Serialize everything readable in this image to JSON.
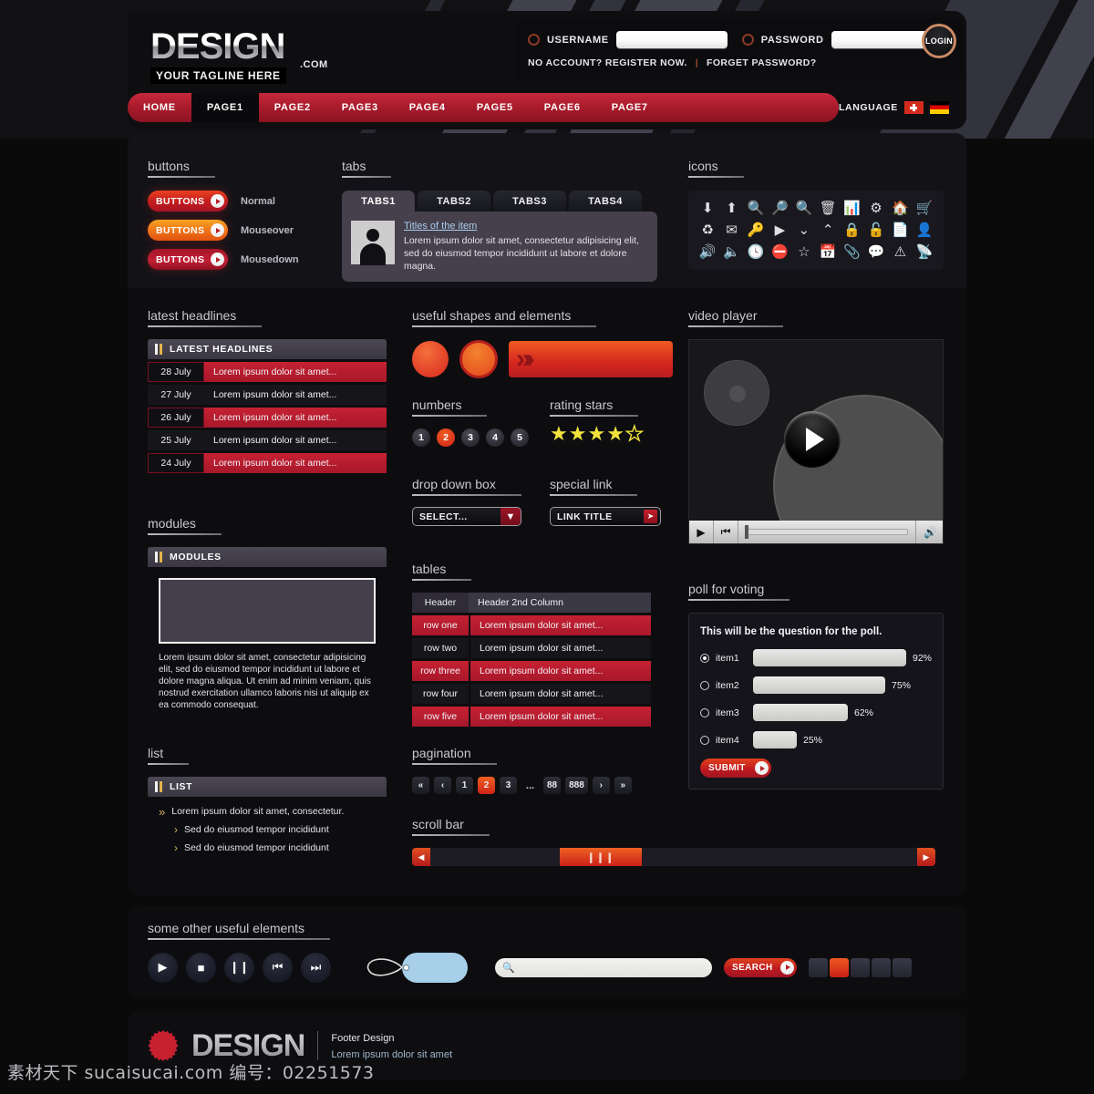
{
  "brand": {
    "logo": "DESIGN",
    "dotcom": ".COM",
    "tagline": "YOUR TAGLINE HERE"
  },
  "login": {
    "username_label": "USERNAME",
    "password_label": "PASSWORD",
    "username_value": "",
    "password_value": "",
    "username_placeholder": "",
    "password_placeholder": "",
    "button_label": "LOGIN",
    "register_link": "NO ACCOUNT? REGISTER NOW.",
    "separator": "|",
    "forgot_link": "FORGET PASSWORD?"
  },
  "nav": {
    "items": [
      {
        "label": "HOME",
        "active": false
      },
      {
        "label": "PAGE1",
        "active": true
      },
      {
        "label": "PAGE2",
        "active": false
      },
      {
        "label": "PAGE3",
        "active": false
      },
      {
        "label": "PAGE4",
        "active": false
      },
      {
        "label": "PAGE5",
        "active": false
      },
      {
        "label": "PAGE6",
        "active": false
      },
      {
        "label": "PAGE7",
        "active": false
      }
    ],
    "language_label": "LANGUAGE",
    "flags": [
      "flag-switzerland",
      "flag-germany"
    ]
  },
  "sections": {
    "buttons": "buttons",
    "tabs": "tabs",
    "icons": "icons",
    "headlines": "latest headlines",
    "shapes": "useful shapes and elements",
    "video": "video player",
    "numbers": "numbers",
    "rating": "rating stars",
    "dropdown": "drop down box",
    "special_link": "special link",
    "modules": "modules",
    "tables": "tables",
    "poll": "poll for voting",
    "list": "list",
    "pagination": "pagination",
    "scrollbar": "scroll bar",
    "other": "some other useful elements"
  },
  "buttons_demo": [
    {
      "label": "BUTTONS",
      "state": "Normal"
    },
    {
      "label": "BUTTONS",
      "state": "Mouseover"
    },
    {
      "label": "BUTTONS",
      "state": "Mousedown"
    }
  ],
  "tabs_demo": {
    "tabs": [
      {
        "label": "TABS1",
        "active": true
      },
      {
        "label": "TABS2",
        "active": false
      },
      {
        "label": "TABS3",
        "active": false
      },
      {
        "label": "TABS4",
        "active": false
      }
    ],
    "title": "Titles of the item",
    "body": "Lorem ipsum dolor sit amet, consectetur adipisicing elit, sed do eiusmod tempor incididunt ut labore et dolore magna."
  },
  "icons_grid": [
    {
      "name": "arrow-down-icon",
      "glyph": "⬇"
    },
    {
      "name": "arrow-up-icon",
      "glyph": "⬆"
    },
    {
      "name": "zoom-in-icon",
      "glyph": "🔍"
    },
    {
      "name": "zoom-out-icon",
      "glyph": "🔎"
    },
    {
      "name": "search-icon",
      "glyph": "🔍"
    },
    {
      "name": "trash-icon",
      "glyph": "🗑"
    },
    {
      "name": "bar-chart-icon",
      "glyph": "📊"
    },
    {
      "name": "gear-icon",
      "glyph": "⚙"
    },
    {
      "name": "home-icon",
      "glyph": "🏠"
    },
    {
      "name": "cart-icon",
      "glyph": "🛒"
    },
    {
      "name": "refresh-icon",
      "glyph": "♻"
    },
    {
      "name": "mail-icon",
      "glyph": "✉"
    },
    {
      "name": "key-icon",
      "glyph": "🔑"
    },
    {
      "name": "play-circle-icon",
      "glyph": "▶"
    },
    {
      "name": "collapse-down-icon",
      "glyph": "⌄"
    },
    {
      "name": "expand-up-icon",
      "glyph": "⌃"
    },
    {
      "name": "lock-closed-icon",
      "glyph": "🔒"
    },
    {
      "name": "lock-open-icon",
      "glyph": "🔓"
    },
    {
      "name": "document-icon",
      "glyph": "📄"
    },
    {
      "name": "user-icon",
      "glyph": "👤"
    },
    {
      "name": "volume-on-icon",
      "glyph": "🔊"
    },
    {
      "name": "volume-off-icon",
      "glyph": "🔈"
    },
    {
      "name": "clock-icon",
      "glyph": "🕓"
    },
    {
      "name": "block-icon",
      "glyph": "⛔"
    },
    {
      "name": "star-icon",
      "glyph": "☆"
    },
    {
      "name": "calendar-icon",
      "glyph": "📅"
    },
    {
      "name": "attachment-icon",
      "glyph": "📎"
    },
    {
      "name": "comment-icon",
      "glyph": "💬"
    },
    {
      "name": "warning-icon",
      "glyph": "⚠"
    },
    {
      "name": "rss-icon",
      "glyph": "📡"
    }
  ],
  "headlines_widget": {
    "title": "LATEST HEADLINES",
    "rows": [
      {
        "date": "28 July",
        "text": "Lorem ipsum dolor sit amet...",
        "highlight": true
      },
      {
        "date": "27 July",
        "text": "Lorem ipsum dolor sit amet...",
        "highlight": false
      },
      {
        "date": "26 July",
        "text": "Lorem ipsum dolor sit amet...",
        "highlight": true
      },
      {
        "date": "25 July",
        "text": "Lorem ipsum dolor sit amet...",
        "highlight": false
      },
      {
        "date": "24 July",
        "text": "Lorem ipsum dolor sit amet...",
        "highlight": true
      }
    ]
  },
  "modules_widget": {
    "title": "MODULES",
    "text": "Lorem ipsum dolor sit amet, consectetur adipisicing elit, sed do eiusmod tempor incididunt ut labore et dolore magna aliqua. Ut enim ad minim veniam, quis nostrud exercitation ullamco laboris nisi ut aliquip ex ea commodo consequat."
  },
  "list_widget": {
    "title": "LIST",
    "items": [
      {
        "text": "Lorem ipsum dolor sit amet, consectetur.",
        "sub": false
      },
      {
        "text": "Sed do eiusmod tempor incididunt",
        "sub": true
      },
      {
        "text": "Sed do eiusmod tempor incididunt",
        "sub": true
      }
    ]
  },
  "numbers_demo": [
    {
      "label": "1",
      "active": false
    },
    {
      "label": "2",
      "active": true
    },
    {
      "label": "3",
      "active": false
    },
    {
      "label": "4",
      "active": false
    },
    {
      "label": "5",
      "active": false
    }
  ],
  "rating": {
    "value": 3.5,
    "max": 5,
    "stars": [
      "full",
      "full",
      "full",
      "half",
      "empty"
    ]
  },
  "dropdown_demo": {
    "value": "SELECT...",
    "options": [
      "SELECT..."
    ]
  },
  "special_link_demo": {
    "label": "LINK TITLE"
  },
  "table_demo": {
    "headers": [
      "Header",
      "Header 2nd Column"
    ],
    "rows": [
      {
        "c1": "row one",
        "c2": "Lorem ipsum dolor sit amet...",
        "highlight": true
      },
      {
        "c1": "row two",
        "c2": "Lorem ipsum dolor sit amet...",
        "highlight": false
      },
      {
        "c1": "row three",
        "c2": "Lorem ipsum dolor sit amet...",
        "highlight": true
      },
      {
        "c1": "row four",
        "c2": "Lorem ipsum dolor sit amet...",
        "highlight": false
      },
      {
        "c1": "row five",
        "c2": "Lorem ipsum dolor sit amet...",
        "highlight": true
      }
    ]
  },
  "pagination_demo": {
    "items": [
      {
        "label": "«",
        "type": "first",
        "active": false
      },
      {
        "label": "‹",
        "type": "prev",
        "active": false
      },
      {
        "label": "1",
        "type": "page",
        "active": false
      },
      {
        "label": "2",
        "type": "page",
        "active": true
      },
      {
        "label": "3",
        "type": "page",
        "active": false
      },
      {
        "label": "...",
        "type": "dots",
        "active": false
      },
      {
        "label": "88",
        "type": "page",
        "active": false
      },
      {
        "label": "888",
        "type": "page",
        "active": false
      },
      {
        "label": "›",
        "type": "next",
        "active": false
      },
      {
        "label": "»",
        "type": "last",
        "active": false
      }
    ]
  },
  "video_player": {
    "play_label": "play-button",
    "controls": [
      "play-icon",
      "prev-icon",
      "seek-bar",
      "volume-icon"
    ]
  },
  "poll_widget": {
    "question": "This will be the question for the poll.",
    "options": [
      {
        "name": "item1",
        "percent": "92%",
        "value": 92,
        "selected": true
      },
      {
        "name": "item2",
        "percent": "75%",
        "value": 75,
        "selected": false
      },
      {
        "name": "item3",
        "percent": "62%",
        "value": 62,
        "selected": false
      },
      {
        "name": "item4",
        "percent": "25%",
        "value": 25,
        "selected": false
      }
    ],
    "submit_label": "SUBMIT"
  },
  "scrollbar_demo": {
    "left_arrow": "◀",
    "right_arrow": "▶",
    "grip": "❙❙❙"
  },
  "other_elements": {
    "media_buttons": [
      {
        "name": "play-icon",
        "glyph": "▶"
      },
      {
        "name": "stop-icon",
        "glyph": "■"
      },
      {
        "name": "pause-icon",
        "glyph": "❙❙"
      },
      {
        "name": "prev-icon",
        "glyph": "⏮"
      },
      {
        "name": "next-icon",
        "glyph": "⏭"
      }
    ],
    "search_value": "",
    "search_placeholder": "",
    "search_button_label": "SEARCH",
    "swatches": [
      {
        "active": false
      },
      {
        "active": true
      },
      {
        "active": false
      },
      {
        "active": false
      },
      {
        "active": false
      }
    ]
  },
  "footer": {
    "logo": "DESIGN",
    "title": "Footer Design",
    "subtitle": "Lorem ipsum dolor sit amet"
  },
  "watermark": "素材天下 sucaisucai.com  编号：02251573",
  "colors": {
    "accent_red": "#c52133",
    "accent_orange": "#ef6124",
    "panel": "#0d0d10",
    "panel_light": "#45404c",
    "gold": "#e0b44a"
  }
}
